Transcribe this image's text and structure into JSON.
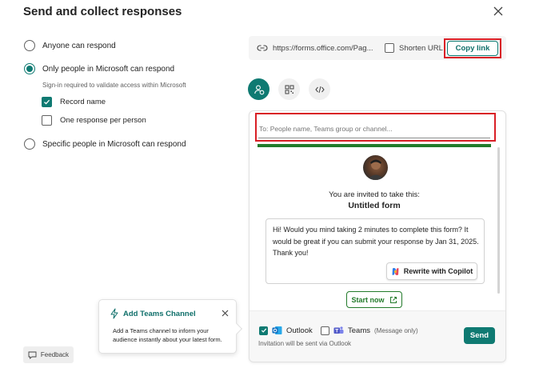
{
  "dialog": {
    "title": "Send and collect responses"
  },
  "access_options": [
    {
      "label": "Anyone can respond",
      "selected": false
    },
    {
      "label": "Only people in Microsoft can respond",
      "selected": true
    },
    {
      "label": "Specific people in Microsoft can respond",
      "selected": false
    }
  ],
  "signin_note": "Sign-in required to validate access within Microsoft",
  "checkboxes": [
    {
      "label": "Record name",
      "checked": true
    },
    {
      "label": "One response per person",
      "checked": false
    }
  ],
  "link": {
    "url": "https://forms.office.com/Pag...",
    "shorten_label": "Shorten URL",
    "shorten_checked": false,
    "copy_label": "Copy link"
  },
  "tabs": [
    {
      "icon": "invite-people-icon",
      "active": true
    },
    {
      "icon": "qr-code-icon",
      "active": false
    },
    {
      "icon": "embed-code-icon",
      "active": false
    }
  ],
  "invite": {
    "to_placeholder": "To: People name, Teams group or channel...",
    "invited_text": "You are invited to take this:",
    "form_name": "Untitled form",
    "message": "Hi! Would you mind taking 2 minutes to complete this form? It would be great if you can submit your response by Jan 31, 2025. Thank you!",
    "rewrite_label": "Rewrite with Copilot",
    "start_label": "Start now"
  },
  "send_options": {
    "outlook_label": "Outlook",
    "outlook_checked": true,
    "teams_label": "Teams",
    "teams_note": "(Message only)",
    "teams_checked": false,
    "via_note": "Invitation will be sent via Outlook",
    "send_label": "Send"
  },
  "teams_tip": {
    "title": "Add Teams Channel",
    "body": "Add a Teams channel to inform your audience instantly about your latest form."
  },
  "feedback_label": "Feedback",
  "colors": {
    "accent": "#0f7a72",
    "green": "#237b2b",
    "highlight": "#d91f26"
  }
}
